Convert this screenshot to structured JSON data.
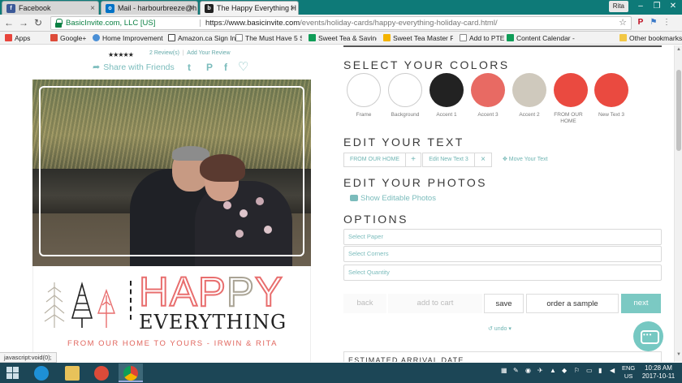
{
  "browser": {
    "tabs": [
      {
        "label": "Facebook",
        "icon": "facebook-icon",
        "color": "#3b5998",
        "glyph": "f"
      },
      {
        "label": "Mail - harbourbreeze@h",
        "icon": "outlook-icon",
        "color": "#0072c6",
        "glyph": "o"
      },
      {
        "label": "The Happy Everything H",
        "icon": "basicinvite-icon",
        "color": "#222222",
        "glyph": "b"
      }
    ],
    "user": "Rita",
    "address": {
      "secure_label": "BasicInvite.com, LLC [US]",
      "url_host": "https://www.basicinvite.com",
      "url_path": "/events/holiday-cards/happy-everything-holiday-card.html/"
    },
    "bookmarks": [
      {
        "label": "Apps",
        "icon": "apps-icon",
        "color": "#e8453c"
      },
      {
        "label": "Google+",
        "icon": "google-plus-icon",
        "color": "#dd4b39"
      },
      {
        "label": "Home Improvement",
        "icon": "bookmark-icon",
        "color": "#4a8fd6"
      },
      {
        "label": "Amazon.ca Sign In",
        "icon": "amazon-icon",
        "color": "#222222"
      },
      {
        "label": "The Must Have 5 Step",
        "icon": "doc-icon",
        "color": "#888888"
      },
      {
        "label": "Sweet Tea & Saving",
        "icon": "sheets-icon",
        "color": "#0f9d58"
      },
      {
        "label": "Sweet Tea Master Fil",
        "icon": "drive-icon",
        "color": "#f4b400"
      },
      {
        "label": "Add to PTE",
        "icon": "doc-icon",
        "color": "#888888"
      },
      {
        "label": "Content Calendar - G",
        "icon": "sheets-icon",
        "color": "#0f9d58"
      },
      {
        "label": "Other bookmarks",
        "icon": "folder-icon",
        "color": "#f2c744"
      }
    ],
    "status_text": "javascript:void(0);"
  },
  "product": {
    "stars": "★★★★★",
    "reviews": "2 Review(s)",
    "review_sep": "|",
    "add_review": "Add Your Review",
    "share": "Share with Friends",
    "social_glyphs": {
      "twitter": "t",
      "pinterest": "P",
      "facebook": "f",
      "heart": "♡"
    },
    "card": {
      "happy_first": "HAP",
      "happy_mid": "P",
      "happy_last": "Y",
      "everything": "EVERYTHING",
      "signature": "FROM OUR HOME TO YOURS - IRWIN & RITA"
    }
  },
  "customize": {
    "colors_heading": "SELECT YOUR COLORS",
    "swatches": [
      {
        "label": "Frame",
        "color": "#ffffff"
      },
      {
        "label": "Background",
        "color": "#ffffff"
      },
      {
        "label": "Accent 1",
        "color": "#222222"
      },
      {
        "label": "Accent 3",
        "color": "#e86a63"
      },
      {
        "label": "Accent 2",
        "color": "#cfc9bd"
      },
      {
        "label": "FROM OUR HOME",
        "color": "#ea4a40"
      },
      {
        "label": "New Text 3",
        "color": "#ea4a40"
      }
    ],
    "text_heading": "EDIT YOUR TEXT",
    "text_buttons": {
      "from_home": "FROM OUR HOME",
      "plus": "+",
      "new_text": "Edit New Text 3",
      "close": "×",
      "move": "✥ Move Your Text"
    },
    "photos_heading": "EDIT YOUR PHOTOS",
    "show_photos": "Show Editable Photos",
    "options_heading": "OPTIONS",
    "selects": {
      "paper": "Select Paper",
      "corners": "Select Corners",
      "quantity": "Select Quantity"
    },
    "actions": {
      "back": "back",
      "add_to_cart": "add to cart",
      "save": "save",
      "sample": "order a sample",
      "next": "next"
    },
    "undo": "↺ undo ▾",
    "arrival": "ESTIMATED ARRIVAL DATE",
    "accent_color": "#7bc9c3"
  },
  "taskbar": {
    "lang_line1": "ENG",
    "lang_line2": "US",
    "time": "10:28 AM",
    "date": "2017-10-11"
  }
}
